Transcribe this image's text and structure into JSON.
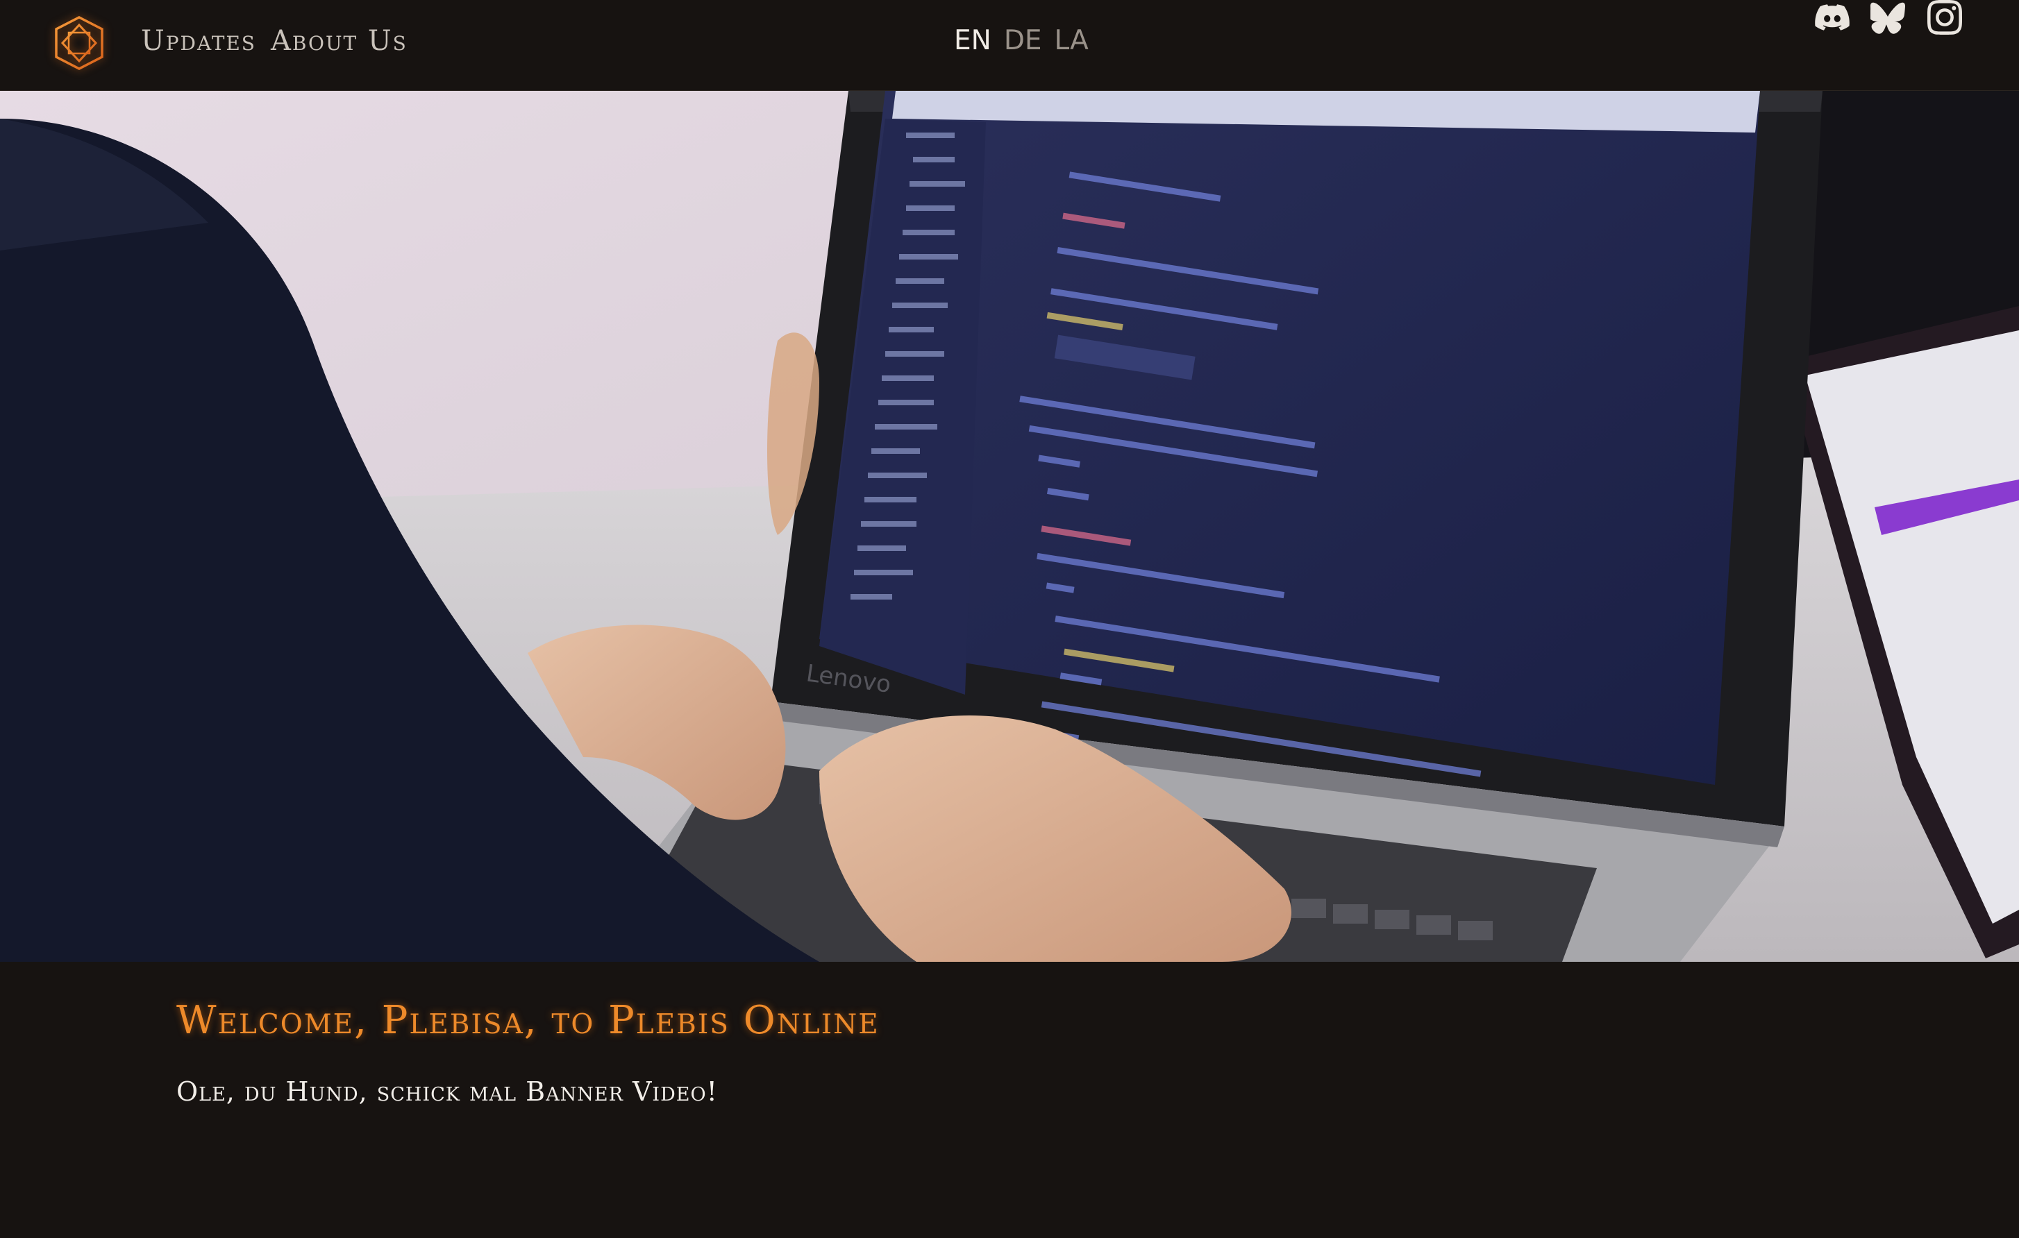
{
  "nav": {
    "links": [
      {
        "label": "Updates"
      },
      {
        "label": "About Us"
      }
    ],
    "languages": [
      {
        "code": "EN",
        "active": true
      },
      {
        "code": "DE",
        "active": false
      },
      {
        "code": "LA",
        "active": false
      }
    ],
    "socials": [
      {
        "icon": "discord-icon"
      },
      {
        "icon": "bluesky-icon"
      },
      {
        "icon": "instagram-icon"
      }
    ]
  },
  "hero": {
    "laptop_brand": "Lenovo"
  },
  "main": {
    "title": "Welcome, Plebisa, to Plebis Online",
    "subtitle": "Ole, du Hund, schick mal Banner Video!"
  },
  "colors": {
    "background": "#171311",
    "accent": "#ee8a2a",
    "nav_text": "#c9c2ba"
  }
}
